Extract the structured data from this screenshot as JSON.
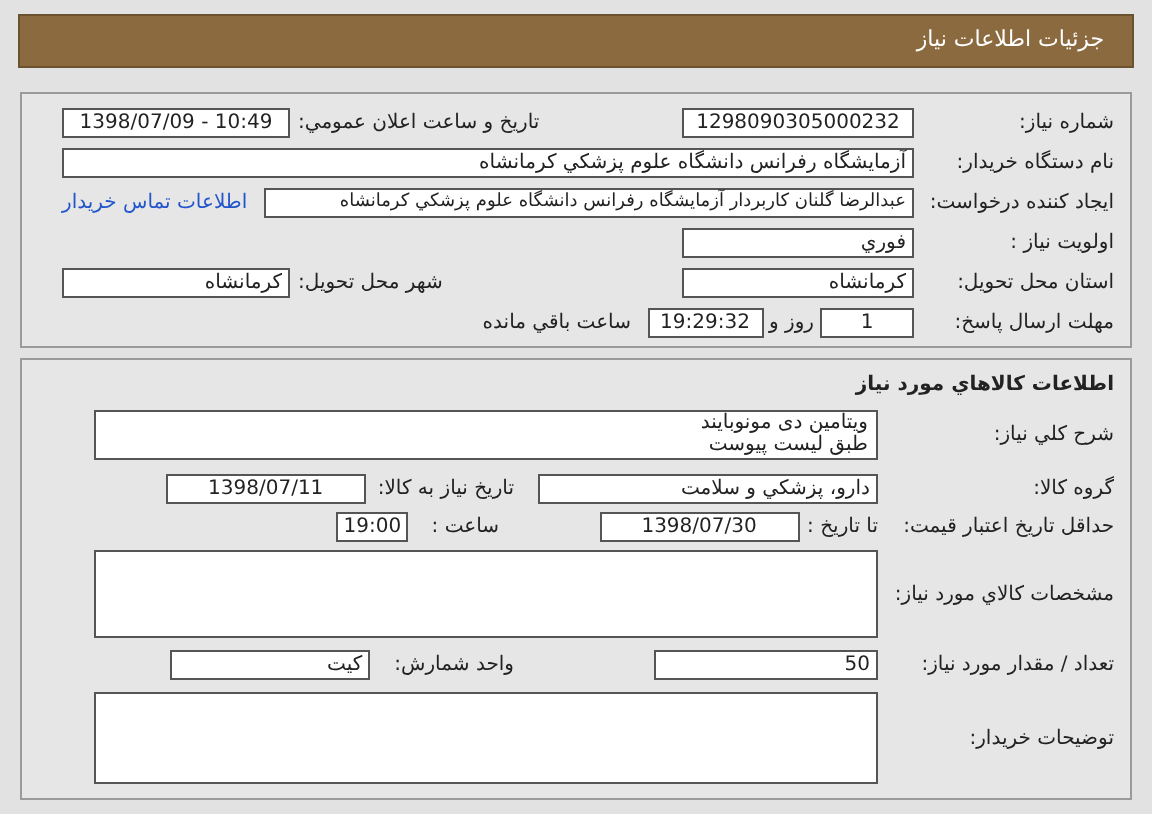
{
  "header": {
    "title": "جزئيات اطلاعات نياز"
  },
  "need": {
    "need_number": {
      "label": "شماره نياز:",
      "value": "1298090305000232"
    },
    "announce_datetime": {
      "label": "تاريخ و ساعت اعلان عمومي:",
      "value": "1398/07/09 - 10:49"
    },
    "buyer_org": {
      "label": "نام دستگاه خريدار:",
      "value": "آزمايشگاه رفرانس دانشگاه علوم پزشكي كرمانشاه"
    },
    "requester": {
      "label": "ايجاد كننده درخواست:",
      "value": "عبدالرضا گلنان كاربردار آزمايشگاه رفرانس دانشگاه علوم پزشكي كرمانشاه",
      "link": "اطلاعات تماس خريدار"
    },
    "priority": {
      "label": "اولويت نياز :",
      "value": "فوري"
    },
    "province": {
      "label": "استان محل تحويل:",
      "value": "كرمانشاه"
    },
    "city": {
      "label": "شهر محل تحويل:",
      "value": "كرمانشاه"
    },
    "deadline": {
      "label": "مهلت ارسال پاسخ:",
      "days": "1",
      "days_label": "روز و",
      "time": "19:29:32",
      "remaining_label": "ساعت باقي مانده"
    }
  },
  "goods": {
    "title": "اطلاعات كالاهاي مورد نياز",
    "summary": {
      "label": "شرح كلي نياز:",
      "lines": [
        "ويتامين دی مونوبايند",
        "طبق ليست پيوست"
      ]
    },
    "group": {
      "label": "گروه كالا:",
      "value": "دارو، پزشكي و سلامت"
    },
    "need_date": {
      "label": "تاريخ نياز به كالا:",
      "value": "1398/07/11"
    },
    "price_validity": {
      "label": "حداقل تاريخ اعتبار قيمت:",
      "to_label": "تا تاريخ :",
      "date": "1398/07/30",
      "time_label": "ساعت :",
      "time": "19:00"
    },
    "specs": {
      "label": "مشخصات كالاي مورد نياز:"
    },
    "quantity": {
      "label": "تعداد / مقدار مورد نياز:",
      "value": "50"
    },
    "unit": {
      "label": "واحد شمارش:",
      "value": "كيت"
    },
    "buyer_notes": {
      "label": "توضيحات خريدار:"
    }
  }
}
